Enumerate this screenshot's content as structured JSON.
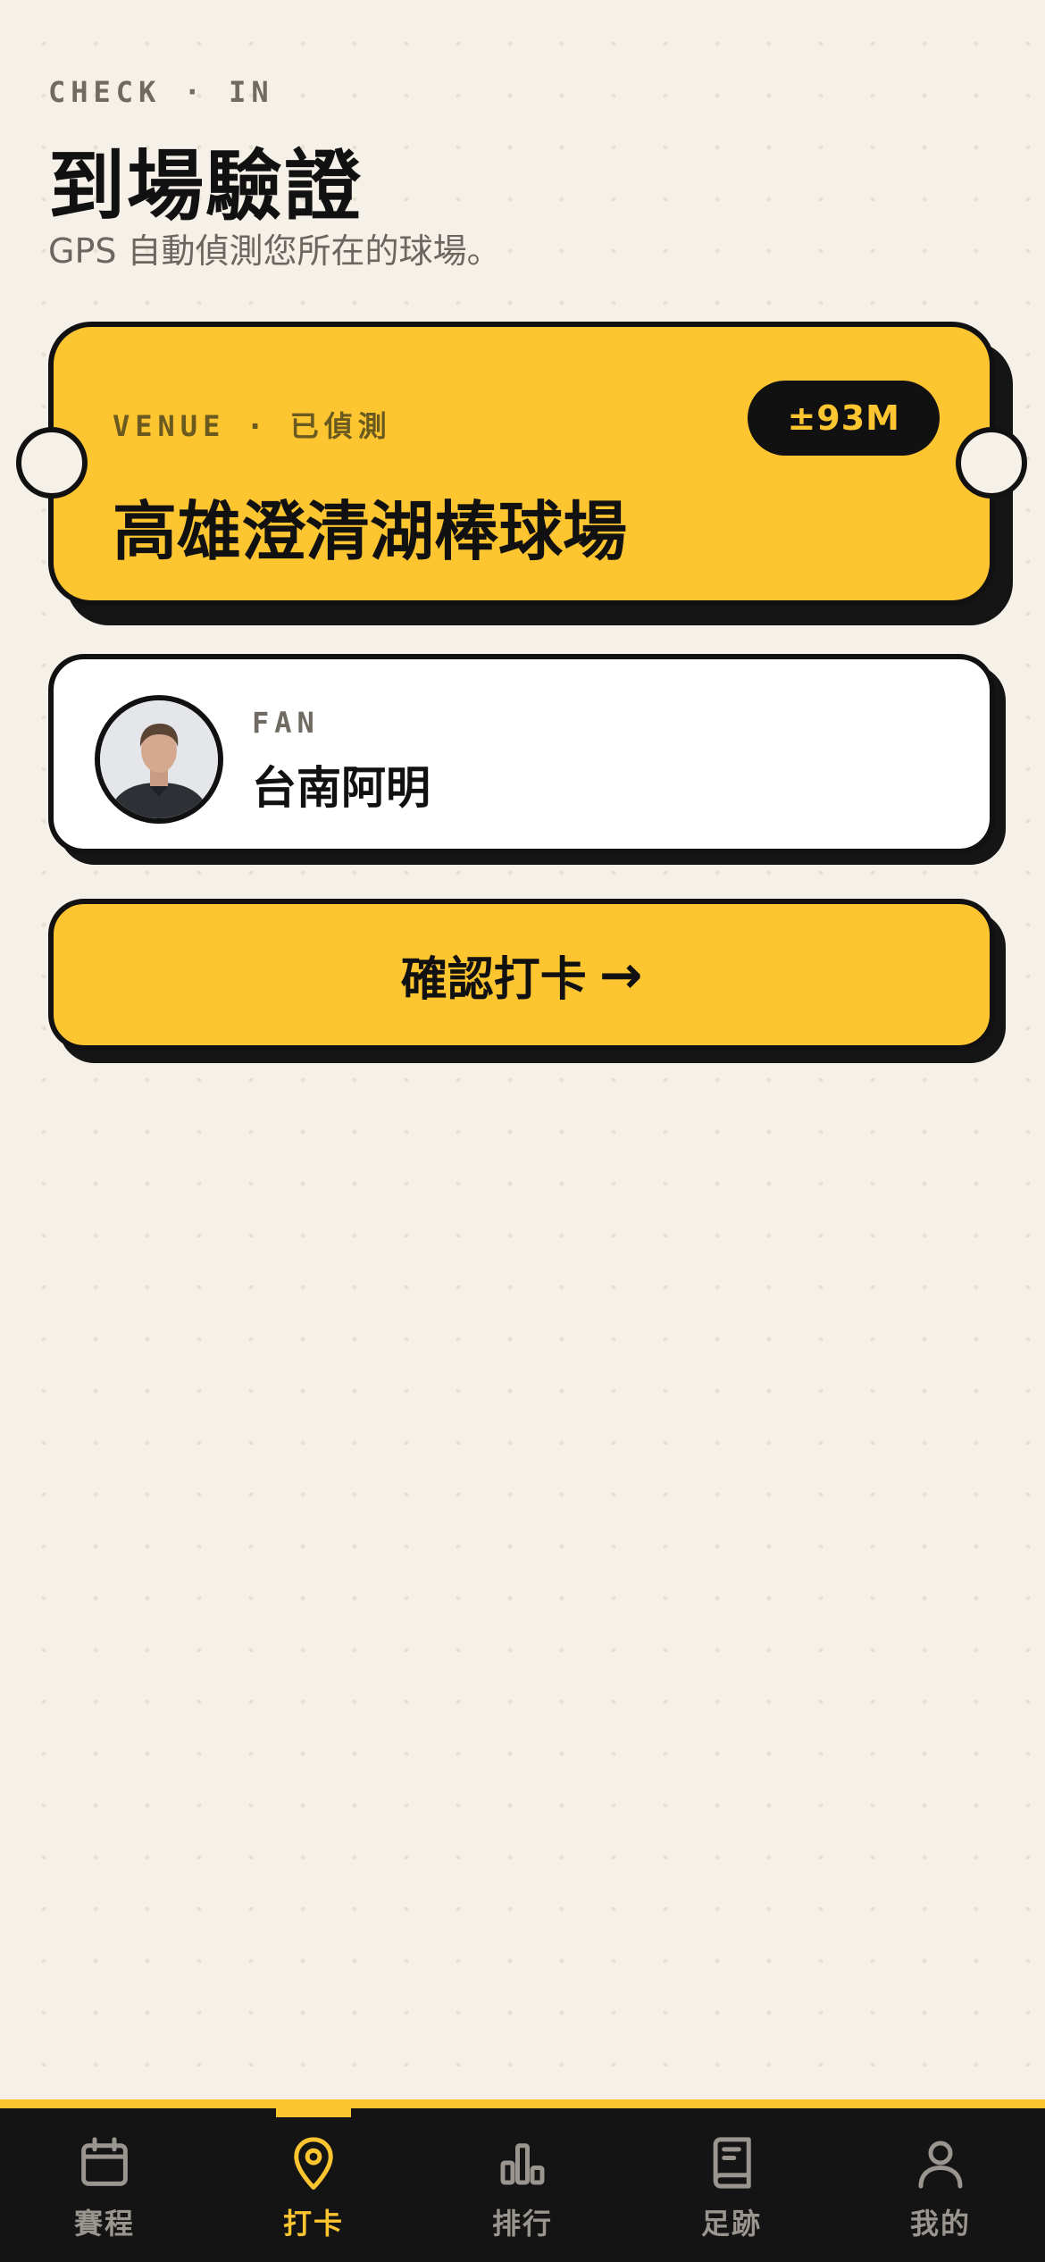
{
  "header": {
    "eyebrow": "CHECK · IN",
    "title": "到場驗證",
    "subtitle": "GPS 自動偵測您所在的球場。"
  },
  "venue": {
    "label": "VENUE",
    "separator": "·",
    "status": "已偵測",
    "accuracy": "±93M",
    "name": "高雄澄清湖棒球場"
  },
  "fan": {
    "role": "FAN",
    "name": "台南阿明"
  },
  "confirm": {
    "label": "確認打卡",
    "arrow": "→"
  },
  "tabs": [
    {
      "label": "賽程",
      "icon": "calendar-icon",
      "active": false
    },
    {
      "label": "打卡",
      "icon": "location-pin-icon",
      "active": true
    },
    {
      "label": "排行",
      "icon": "bar-chart-icon",
      "active": false
    },
    {
      "label": "足跡",
      "icon": "book-icon",
      "active": false
    },
    {
      "label": "我的",
      "icon": "person-icon",
      "active": false
    }
  ],
  "colors": {
    "accent": "#fdc52f",
    "background": "#f5f1e8",
    "ink": "#141414"
  }
}
